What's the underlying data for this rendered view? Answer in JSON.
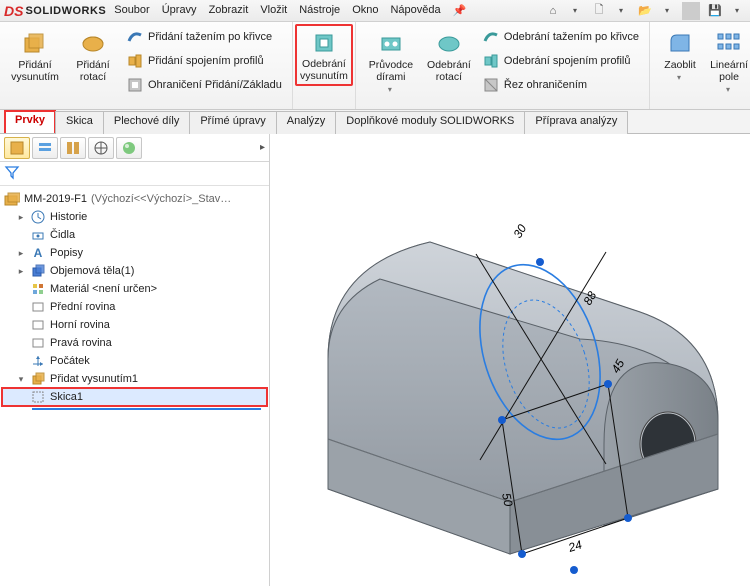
{
  "title": {
    "brand": "SOLIDWORKS"
  },
  "menus": [
    "Soubor",
    "Úpravy",
    "Zobrazit",
    "Vložit",
    "Nástroje",
    "Okno",
    "Nápověda"
  ],
  "ribbon": {
    "pridani_vysunutim": "Přidání vysunutím",
    "pridani_rotaci": "Přidání rotací",
    "tazeni_krivka": "Přidání tažením po křivce",
    "spojeni_profilu": "Přidání spojením profilů",
    "ohraniceni": "Ohraničení Přidání/Základu",
    "odebrani_vysunutim": "Odebrání vysunutím",
    "pruvodce_dirami": "Průvodce dírami",
    "odebrani_rotaci": "Odebrání rotací",
    "odebrani_tazeni": "Odebrání tažením po křivce",
    "odebrani_spojeni": "Odebrání spojením profilů",
    "rez_ohranicenim": "Řez ohraničením",
    "zaoblit": "Zaoblit",
    "linearni_pole": "Lineární pole"
  },
  "command_tabs": [
    "Prvky",
    "Skica",
    "Plechové díly",
    "Přímé úpravy",
    "Analýzy",
    "Doplňkové moduly SOLIDWORKS",
    "Příprava analýzy"
  ],
  "tree": {
    "root": "MM-2019-F1",
    "root_suffix": "(Výchozí<<Výchozí>_Stav…",
    "historie": "Historie",
    "cidla": "Čidla",
    "popisy": "Popisy",
    "obj_tela": "Objemová těla(1)",
    "material": "Materiál <není určen>",
    "predni": "Přední rovina",
    "horni": "Horní rovina",
    "prava": "Pravá rovina",
    "pocatek": "Počátek",
    "vysunuti1": "Přidat vysunutím1",
    "skica1": "Skica1"
  },
  "sketch_dims": {
    "d1": "30",
    "d2": "88",
    "d3": "45",
    "d4": "50",
    "d5": "24"
  }
}
